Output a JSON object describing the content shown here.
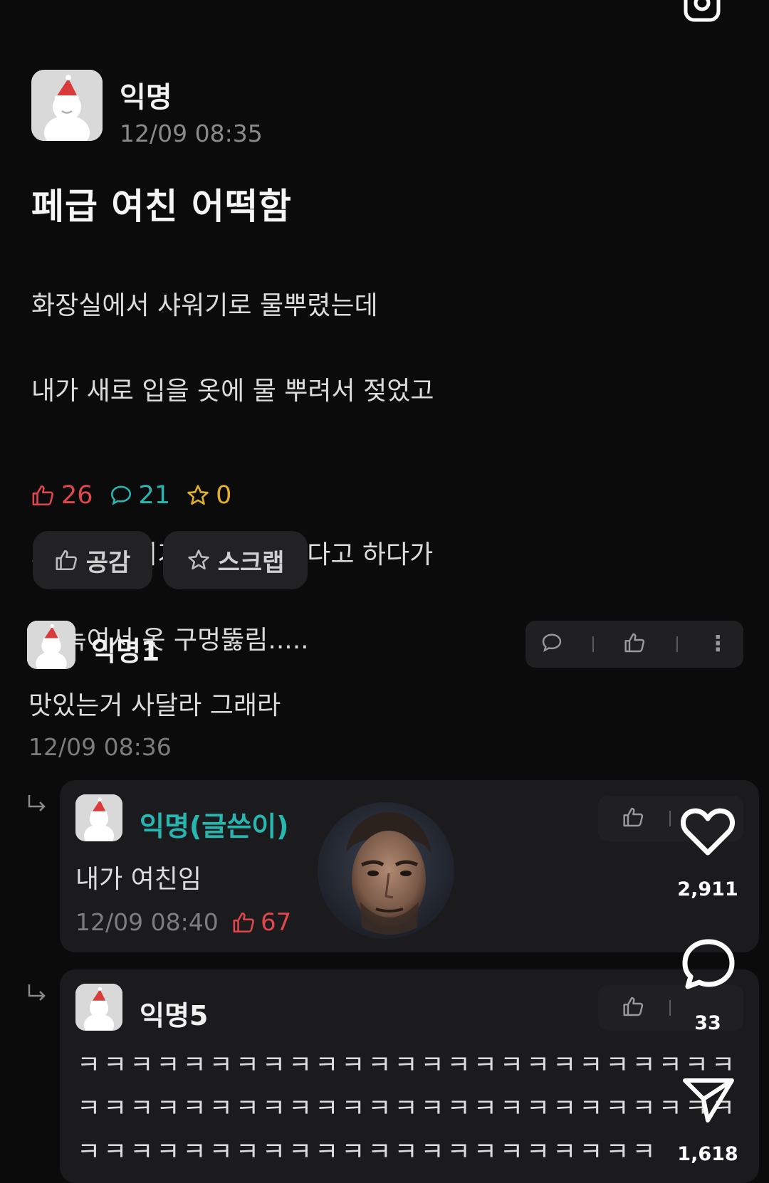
{
  "post": {
    "author": "익명",
    "time": "12/09 08:35",
    "title": "페급 여친 어떡함",
    "body_lines": [
      "화장실에서 샤워기로 물뿌렸는데",
      "내가 새로 입을 옷에 물 뿌려서 젖었고",
      "",
      "그거 드라이기로 말려보겠다고 하다가",
      "옷 녹여서 옷 구멍뚫림....."
    ],
    "stats": {
      "likes": "26",
      "comments": "21",
      "scraps": "0"
    },
    "buttons": {
      "empathy": "공감",
      "scrap": "스크랩"
    }
  },
  "comments": [
    {
      "author": "익명1",
      "text": "맛있는거 사달라 그래라",
      "time": "12/09 08:36"
    }
  ],
  "replies": [
    {
      "author": "익명(글쓴이)",
      "text": "내가 여친임",
      "time": "12/09 08:40",
      "likes": "67"
    },
    {
      "author": "익명5",
      "text_lines": [
        "ㅋㅋㅋㅋㅋㅋㅋㅋㅋㅋㅋㅋㅋㅋㅋㅋㅋㅋㅋㅋㅋㅋㅋㅋㅋ",
        "ㅋㅋㅋㅋㅋㅋㅋㅋㅋㅋㅋㅋㅋㅋㅋㅋㅋㅋㅋㅋㅋㅋㅋㅋㅋ",
        "ㅋㅋㅋㅋㅋㅋㅋㅋㅋㅋㅋㅋㅋㅋㅋㅋㅋㅋㅋㅋㅋㅋ"
      ]
    }
  ],
  "overlay": {
    "likes": "2,911",
    "comments": "33",
    "shares": "1,618"
  },
  "icons": {
    "like": "thumbs-up-icon",
    "comment": "speech-bubble-icon",
    "scrap": "star-icon",
    "more": "vertical-dots-icon",
    "reply": "reply-arrow-icon",
    "heart": "heart-icon",
    "share": "paper-plane-icon",
    "camera": "camera-icon"
  },
  "colors": {
    "background": "#0b0b0c",
    "like": "#e0474c",
    "comment": "#27b7b0",
    "scrap": "#e3b22a",
    "op_name": "#27b7b0"
  }
}
